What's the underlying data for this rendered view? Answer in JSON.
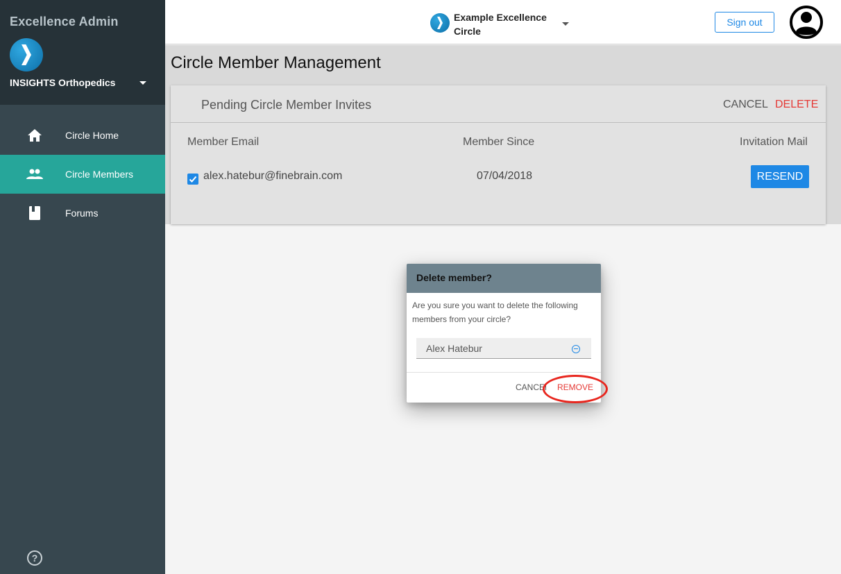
{
  "sidebar": {
    "app_title": "Excellence Admin",
    "org_name": "INSIGHTS Orthopedics",
    "items": [
      {
        "label": "Circle Home",
        "icon": "home-icon"
      },
      {
        "label": "Circle Members",
        "icon": "people-icon",
        "active": true
      },
      {
        "label": "Forums",
        "icon": "book-icon"
      }
    ],
    "help_icon": "help-icon"
  },
  "header": {
    "circle_name": "Example Excellence Circle",
    "sign_out_label": "Sign out",
    "avatar_icon": "account-icon"
  },
  "page": {
    "title": "Circle Member Management"
  },
  "invites_card": {
    "title": "Pending Circle Member Invites",
    "cancel_label": "CANCEL",
    "delete_label": "DELETE",
    "columns": [
      "Member Email",
      "Member Since",
      "Invitation Mail"
    ],
    "rows": [
      {
        "email": "alex.hatebur@finebrain.com",
        "since": "07/04/2018",
        "action": "RESEND",
        "checked": true
      }
    ]
  },
  "dialog": {
    "title": "Delete member?",
    "message": "Are you sure you want to delete the following members from your circle?",
    "members": [
      "Alex Hatebur"
    ],
    "cancel_label": "CANCEL",
    "remove_label": "REMOVE"
  },
  "colors": {
    "accent": "#1e88e5",
    "danger": "#e53935",
    "sidebar_bg": "#37474f",
    "active_item": "#26a69a",
    "dialog_header": "#6e838e"
  }
}
